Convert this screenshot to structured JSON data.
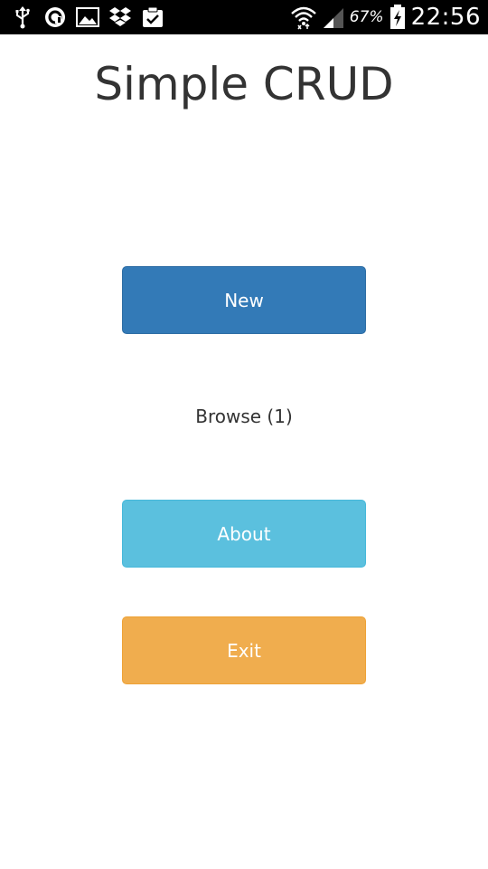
{
  "status_bar": {
    "left_icons": [
      "usb-icon",
      "sync-icon",
      "gallery-icon",
      "dropbox-icon",
      "clipboard-check-icon"
    ],
    "right_icons": [
      "wifi-icon",
      "signal-icon",
      "battery-charging-icon"
    ],
    "battery_percent": "67%",
    "time": "22:56"
  },
  "app": {
    "title": "Simple CRUD"
  },
  "menu": {
    "new_label": "New",
    "browse_label": "Browse (1)",
    "about_label": "About",
    "exit_label": "Exit"
  },
  "colors": {
    "new": "#337ab7",
    "about": "#5bc0de",
    "exit": "#f0ad4e",
    "title": "#333333"
  }
}
